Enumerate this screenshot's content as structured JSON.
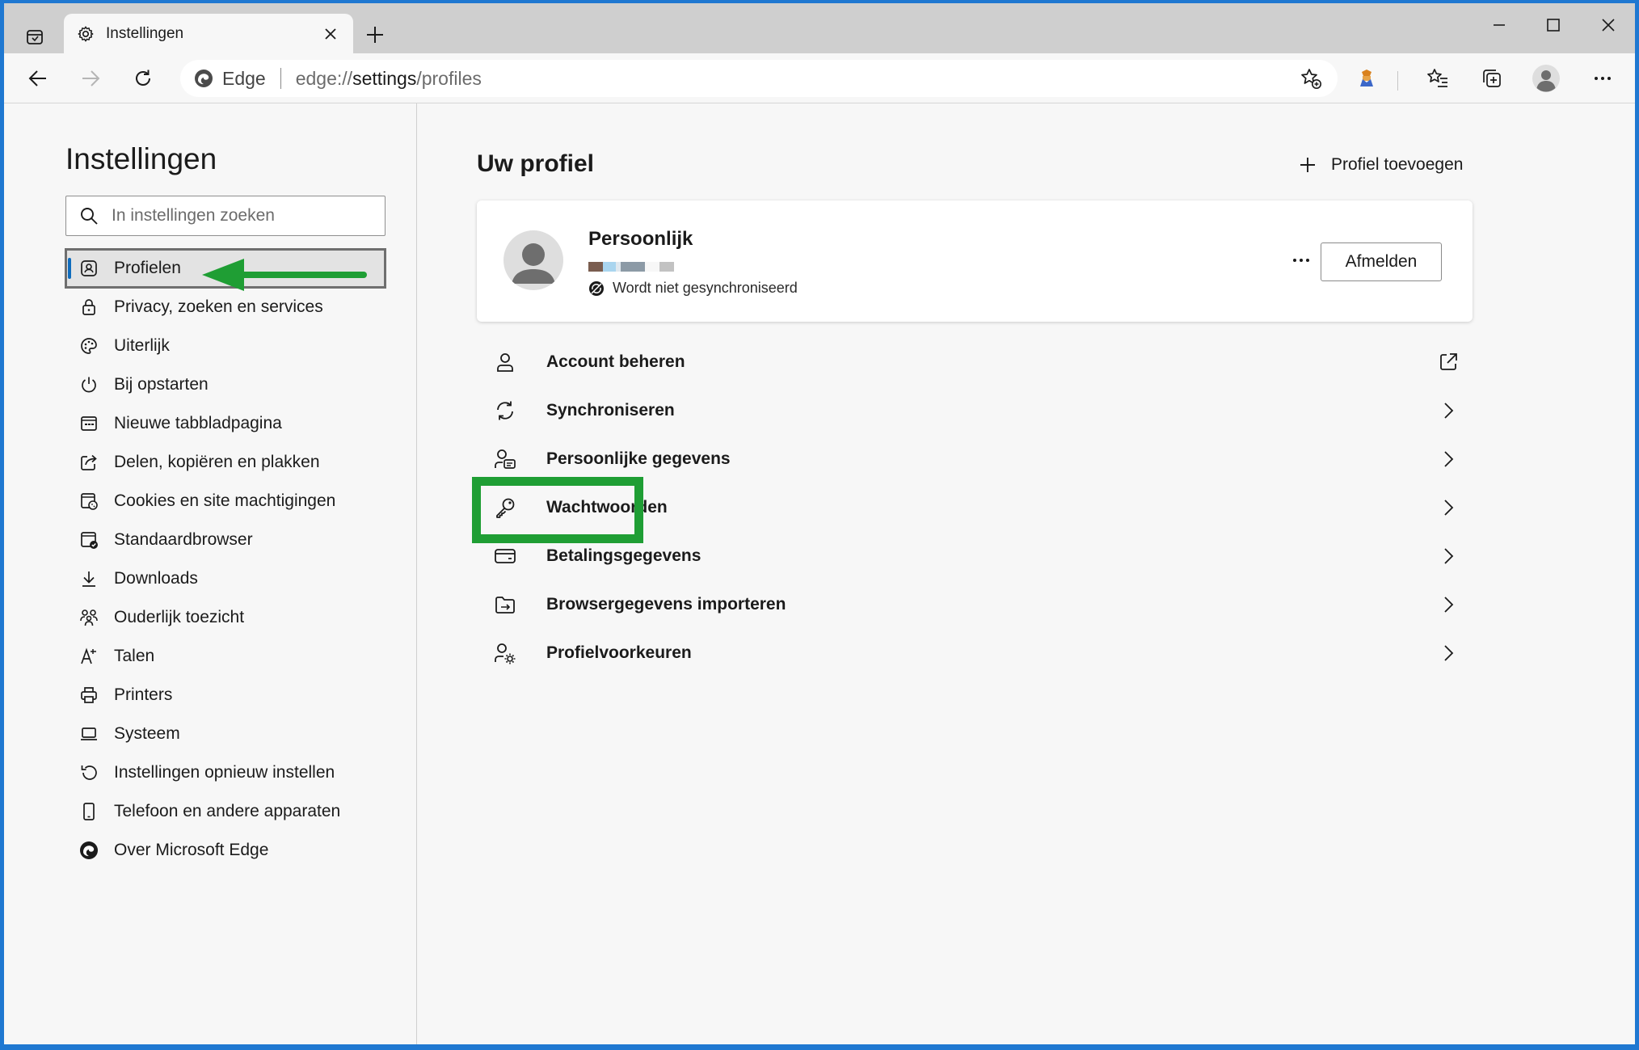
{
  "tab": {
    "title": "Instellingen"
  },
  "omnibox": {
    "site_label": "Edge",
    "url_prefix": "edge://",
    "url_host": "settings",
    "url_path": "/profiles"
  },
  "sidebar": {
    "title": "Instellingen",
    "search_placeholder": "In instellingen zoeken",
    "items": [
      {
        "label": "Profielen",
        "icon": "profile-icon",
        "active": true
      },
      {
        "label": "Privacy, zoeken en services",
        "icon": "lock-icon"
      },
      {
        "label": "Uiterlijk",
        "icon": "palette-icon"
      },
      {
        "label": "Bij opstarten",
        "icon": "power-icon"
      },
      {
        "label": "Nieuwe tabbladpagina",
        "icon": "new-tab-page-icon"
      },
      {
        "label": "Delen, kopiëren en plakken",
        "icon": "share-icon"
      },
      {
        "label": "Cookies en site machtigingen",
        "icon": "cookies-icon"
      },
      {
        "label": "Standaardbrowser",
        "icon": "default-browser-icon"
      },
      {
        "label": "Downloads",
        "icon": "download-icon"
      },
      {
        "label": "Ouderlijk toezicht",
        "icon": "family-icon"
      },
      {
        "label": "Talen",
        "icon": "language-icon"
      },
      {
        "label": "Printers",
        "icon": "printer-icon"
      },
      {
        "label": "Systeem",
        "icon": "laptop-icon"
      },
      {
        "label": "Instellingen opnieuw instellen",
        "icon": "reset-icon"
      },
      {
        "label": "Telefoon en andere apparaten",
        "icon": "phone-icon"
      },
      {
        "label": "Over Microsoft Edge",
        "icon": "edge-logo-icon"
      }
    ]
  },
  "main": {
    "title": "Uw profiel",
    "add_profile_label": "Profiel toevoegen",
    "profile": {
      "name": "Persoonlijk",
      "sync_status": "Wordt niet gesynchroniseerd",
      "signout_label": "Afmelden"
    },
    "rows": [
      {
        "label": "Account beheren",
        "icon": "person-icon",
        "trail": "external-link-icon"
      },
      {
        "label": "Synchroniseren",
        "icon": "sync-icon",
        "trail": "chevron-right-icon"
      },
      {
        "label": "Persoonlijke gegevens",
        "icon": "personal-info-icon",
        "trail": "chevron-right-icon"
      },
      {
        "label": "Wachtwoorden",
        "icon": "key-icon",
        "trail": "chevron-right-icon"
      },
      {
        "label": "Betalingsgegevens",
        "icon": "credit-card-icon",
        "trail": "chevron-right-icon"
      },
      {
        "label": "Browsergegevens importeren",
        "icon": "import-icon",
        "trail": "chevron-right-icon"
      },
      {
        "label": "Profielvoorkeuren",
        "icon": "profile-preferences-icon",
        "trail": "chevron-right-icon"
      }
    ]
  },
  "colors": {
    "accent": "#0f6cbd",
    "annotation": "#1f9e34",
    "desktop": "#1f78d1"
  }
}
